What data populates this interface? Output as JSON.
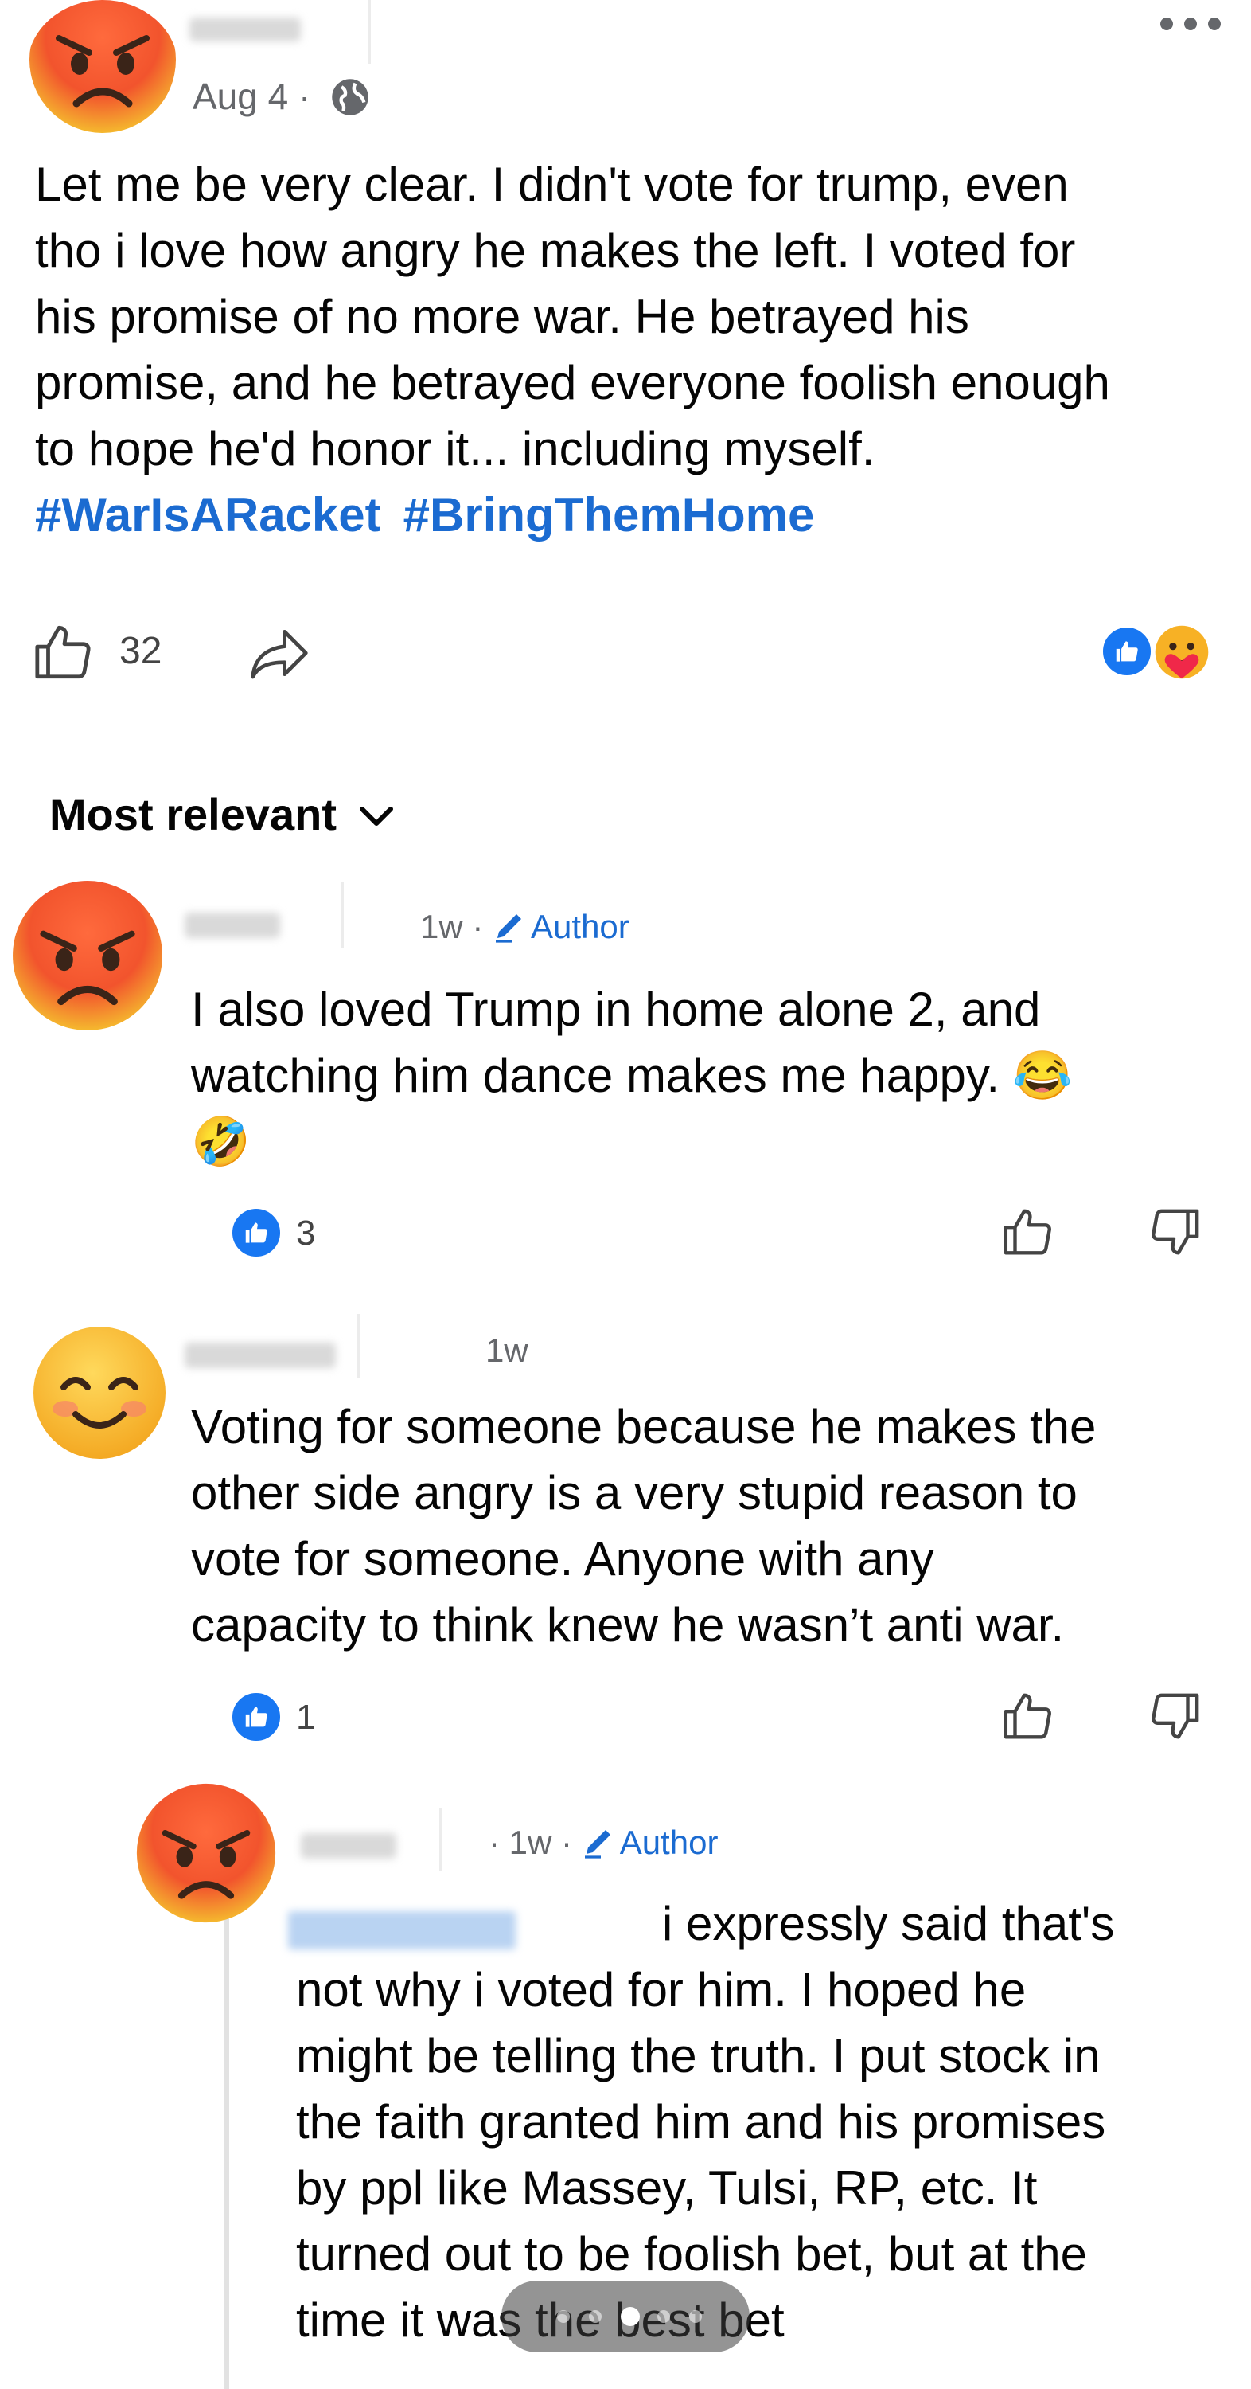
{
  "post": {
    "timestamp": "Aug 4",
    "separator": "·",
    "privacy_icon": "globe-icon",
    "more_icon": "more-options-icon",
    "body_lines": [
      "Let me be very clear. I didn't vote for trump, even",
      "tho i love how angry he makes the left. I voted for",
      "his promise of no more war. He betrayed his",
      "promise, and he betrayed everyone foolish enough",
      "to hope he'd honor it... including myself."
    ],
    "hashtags": [
      "#WarIsARacket",
      "#BringThemHome"
    ],
    "like_count": "32",
    "reactions": [
      "like",
      "care"
    ]
  },
  "comments_sort": {
    "label": "Most relevant"
  },
  "comments": [
    {
      "time": "1w",
      "author_badge": "Author",
      "avatar": "angry-emoji",
      "text_lines": [
        "I also loved Trump in home alone 2, and",
        "watching him dance makes me happy. 😂",
        "🤣"
      ],
      "reaction_count": "3"
    },
    {
      "time": "1w",
      "avatar": "smiling-emoji",
      "text_lines": [
        "Voting for someone because he makes the",
        "other side angry is a very stupid reason to",
        "vote for someone. Anyone with any",
        "capacity to think knew he wasn’t anti war."
      ],
      "reaction_count": "1"
    },
    {
      "time": "1w",
      "author_badge": "Author",
      "avatar": "angry-emoji",
      "text_lines": [
        "i expressly said that's",
        "not why i voted for him. I hoped he",
        "might be telling the truth. I put stock in",
        "the faith granted him and his promises",
        "by ppl like Massey, Tulsi, RP, etc. It",
        "turned out to be foolish bet,  but at the",
        "time it was the best bet"
      ]
    }
  ],
  "colors": {
    "link_blue": "#1b6bd1",
    "like_blue": "#1877f2",
    "meta_gray": "#65676b"
  }
}
